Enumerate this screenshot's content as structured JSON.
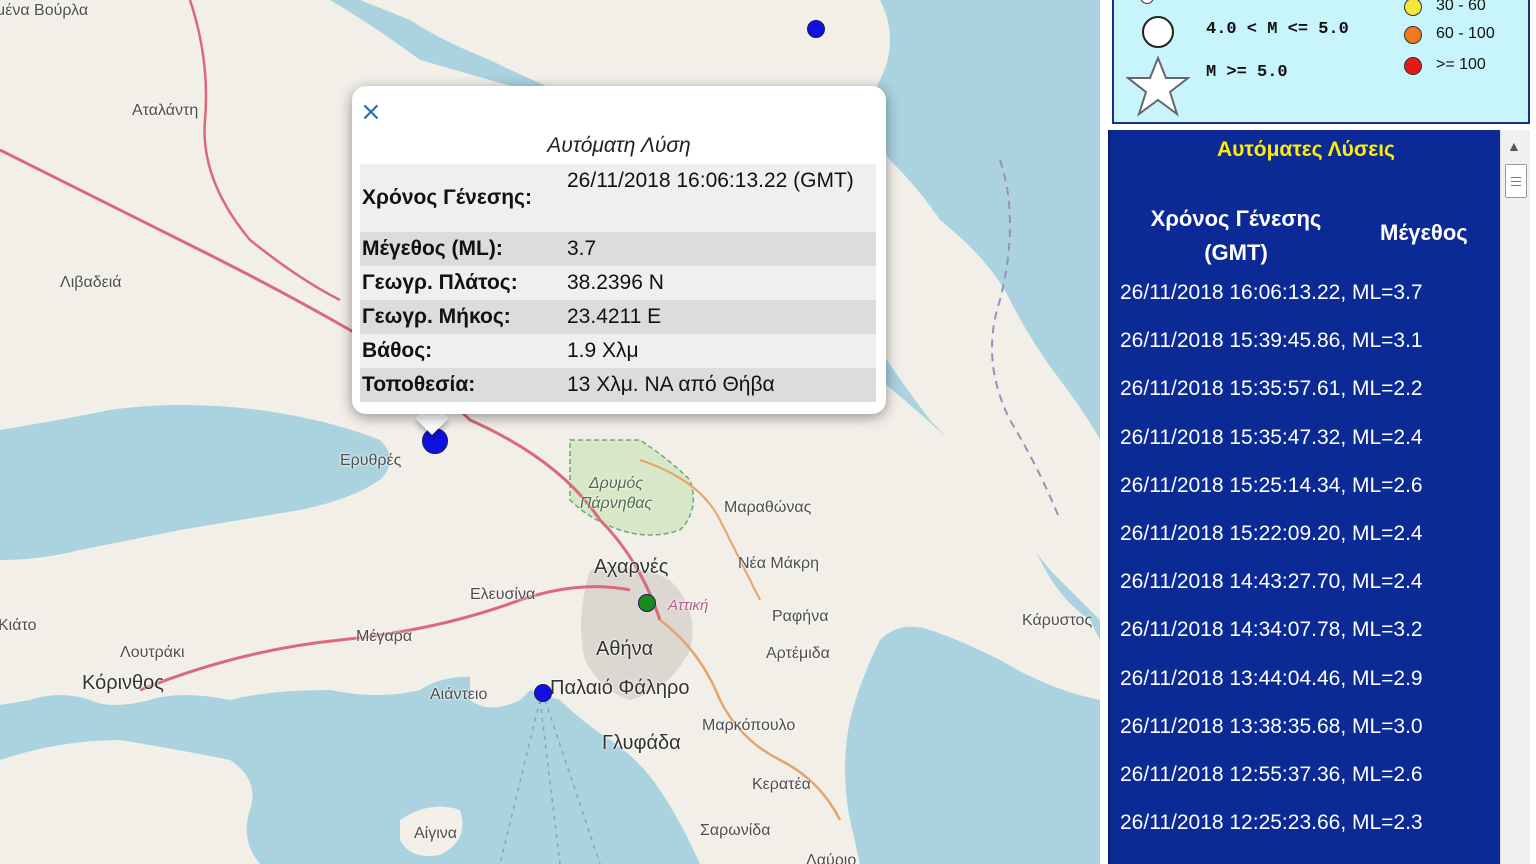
{
  "map": {
    "places": [
      {
        "name": "μένα Βούρλα"
      },
      {
        "name": "Αταλάντη"
      },
      {
        "name": "Λιβαδειά"
      },
      {
        "name": "Ερυθρές"
      },
      {
        "name": "Δρυμός Πάρνηθας"
      },
      {
        "name": "Μαραθώνας"
      },
      {
        "name": "Αχαρνές"
      },
      {
        "name": "Νέα Μάκρη"
      },
      {
        "name": "Ελευσίνα"
      },
      {
        "name": "Αττική"
      },
      {
        "name": "Ραφήνα"
      },
      {
        "name": "Μέγαρα"
      },
      {
        "name": "Αθήνα"
      },
      {
        "name": "Κάρυστος"
      },
      {
        "name": "Λουτράκι"
      },
      {
        "name": "Αρτέμιδα"
      },
      {
        "name": "Κόρινθος"
      },
      {
        "name": "Αιάντειο"
      },
      {
        "name": "Παλαιό Φάληρο"
      },
      {
        "name": "Μαρκόπουλο"
      },
      {
        "name": "Γλυφάδα"
      },
      {
        "name": "Κερατέα"
      },
      {
        "name": "Αίγινα"
      },
      {
        "name": "Σαρωνίδα"
      },
      {
        "name": "Λαύριο"
      },
      {
        "name": "Κιάτο"
      }
    ]
  },
  "popup": {
    "close_icon": "×",
    "title": "Αυτόματη Λύση",
    "rows": [
      {
        "label": "Χρόνος Γένεσης:",
        "value": "26/11/2018 16:06:13.22 (GMT)"
      },
      {
        "label": "Μέγεθος (ML):",
        "value": "3.7"
      },
      {
        "label": "Γεωγρ. Πλάτος:",
        "value": "38.2396 N"
      },
      {
        "label": "Γεωγρ. Μήκος:",
        "value": "23.4211 E"
      },
      {
        "label": "Βάθος:",
        "value": "1.9 Χλμ"
      },
      {
        "label": "Τοποθεσία:",
        "value": "13 Χλμ. ΝΑ από Θήβα"
      }
    ]
  },
  "legend": {
    "mag_mid": "4.0 < M <= 5.0",
    "mag_high": "M >= 5.0",
    "depths": [
      {
        "label": "30 - 60",
        "color": "#f5e63a"
      },
      {
        "label": "60 - 100",
        "color": "#f07a1a"
      },
      {
        "label": ">= 100",
        "color": "#e81818"
      }
    ]
  },
  "list": {
    "title": "Αυτόματες Λύσεις",
    "header_time": "Χρόνος Γένεσης (GMT)",
    "header_mag": "Μέγεθος",
    "rows": [
      "26/11/2018 16:06:13.22, ML=3.7",
      "26/11/2018 15:39:45.86, ML=3.1",
      "26/11/2018 15:35:57.61, ML=2.2",
      "26/11/2018 15:35:47.32, ML=2.4",
      "26/11/2018 15:25:14.34, ML=2.6",
      "26/11/2018 15:22:09.20, ML=2.4",
      "26/11/2018 14:43:27.70, ML=2.4",
      "26/11/2018 14:34:07.78, ML=3.2",
      "26/11/2018 13:44:04.46, ML=2.9",
      "26/11/2018 13:38:35.68, ML=3.0",
      "26/11/2018 12:55:37.36, ML=2.6",
      "26/11/2018 12:25:23.66, ML=2.3"
    ]
  },
  "colors": {
    "sea": "#aad3df",
    "land": "#f2efe9",
    "quake_blue": "#1010e0",
    "quake_green": "#1a8a1a",
    "panel_blue": "#0c2a96",
    "panel_title": "#ffee00",
    "legend_bg": "#c8f4fb"
  }
}
